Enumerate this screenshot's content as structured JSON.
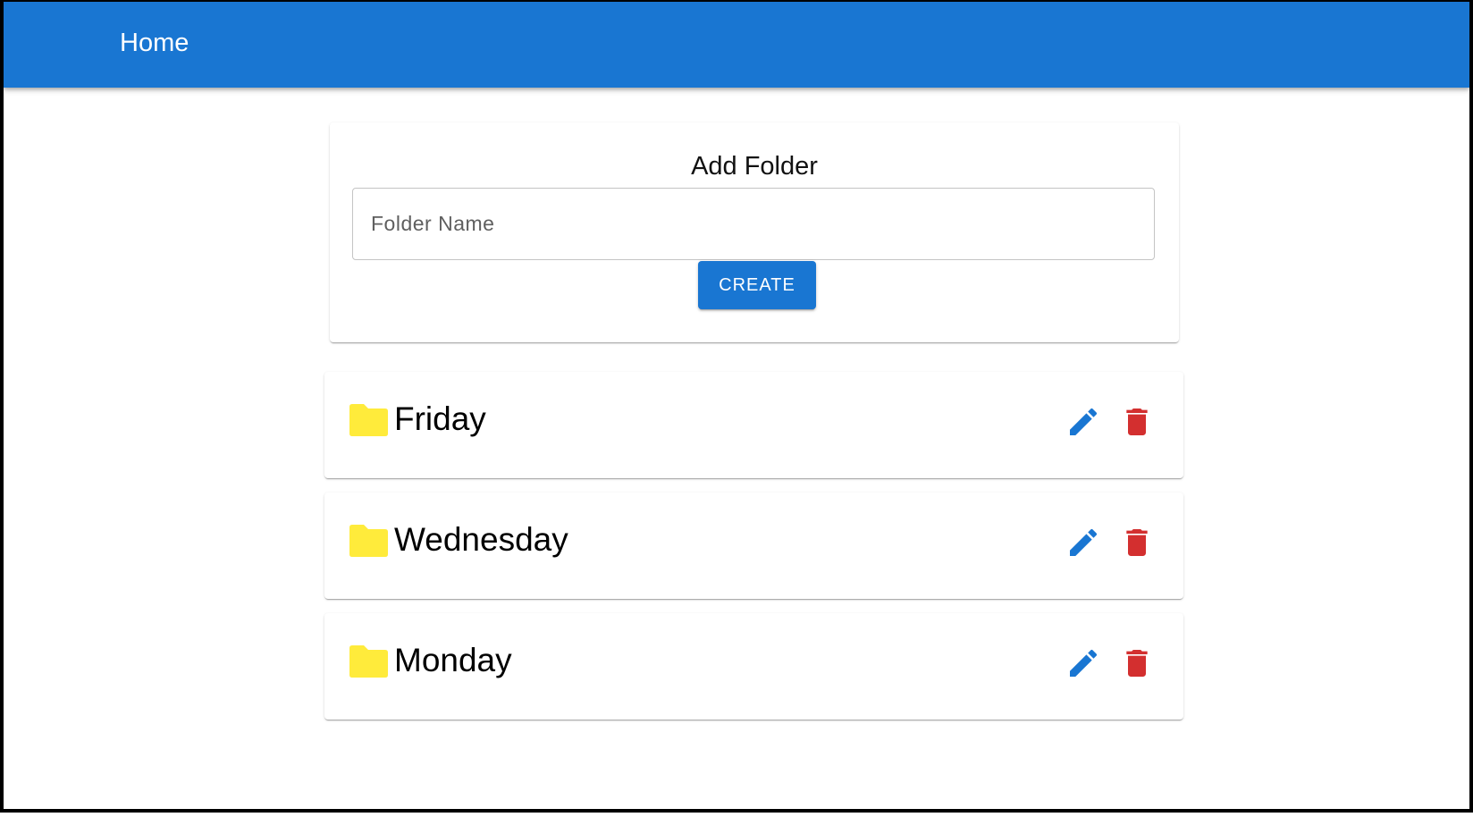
{
  "appbar": {
    "title": "Home",
    "color": "#1976d2"
  },
  "add_folder": {
    "title": "Add Folder",
    "input_placeholder": "Folder Name",
    "input_value": "",
    "create_label": "CREATE"
  },
  "folders": [
    {
      "name": "Friday",
      "icon": "folder-icon",
      "edit_icon": "pencil-icon",
      "delete_icon": "trash-icon"
    },
    {
      "name": "Wednesday",
      "icon": "folder-icon",
      "edit_icon": "pencil-icon",
      "delete_icon": "trash-icon"
    },
    {
      "name": "Monday",
      "icon": "folder-icon",
      "edit_icon": "pencil-icon",
      "delete_icon": "trash-icon"
    }
  ],
  "colors": {
    "primary": "#1976d2",
    "folder": "#ffeb3b",
    "delete": "#d32f2f"
  }
}
